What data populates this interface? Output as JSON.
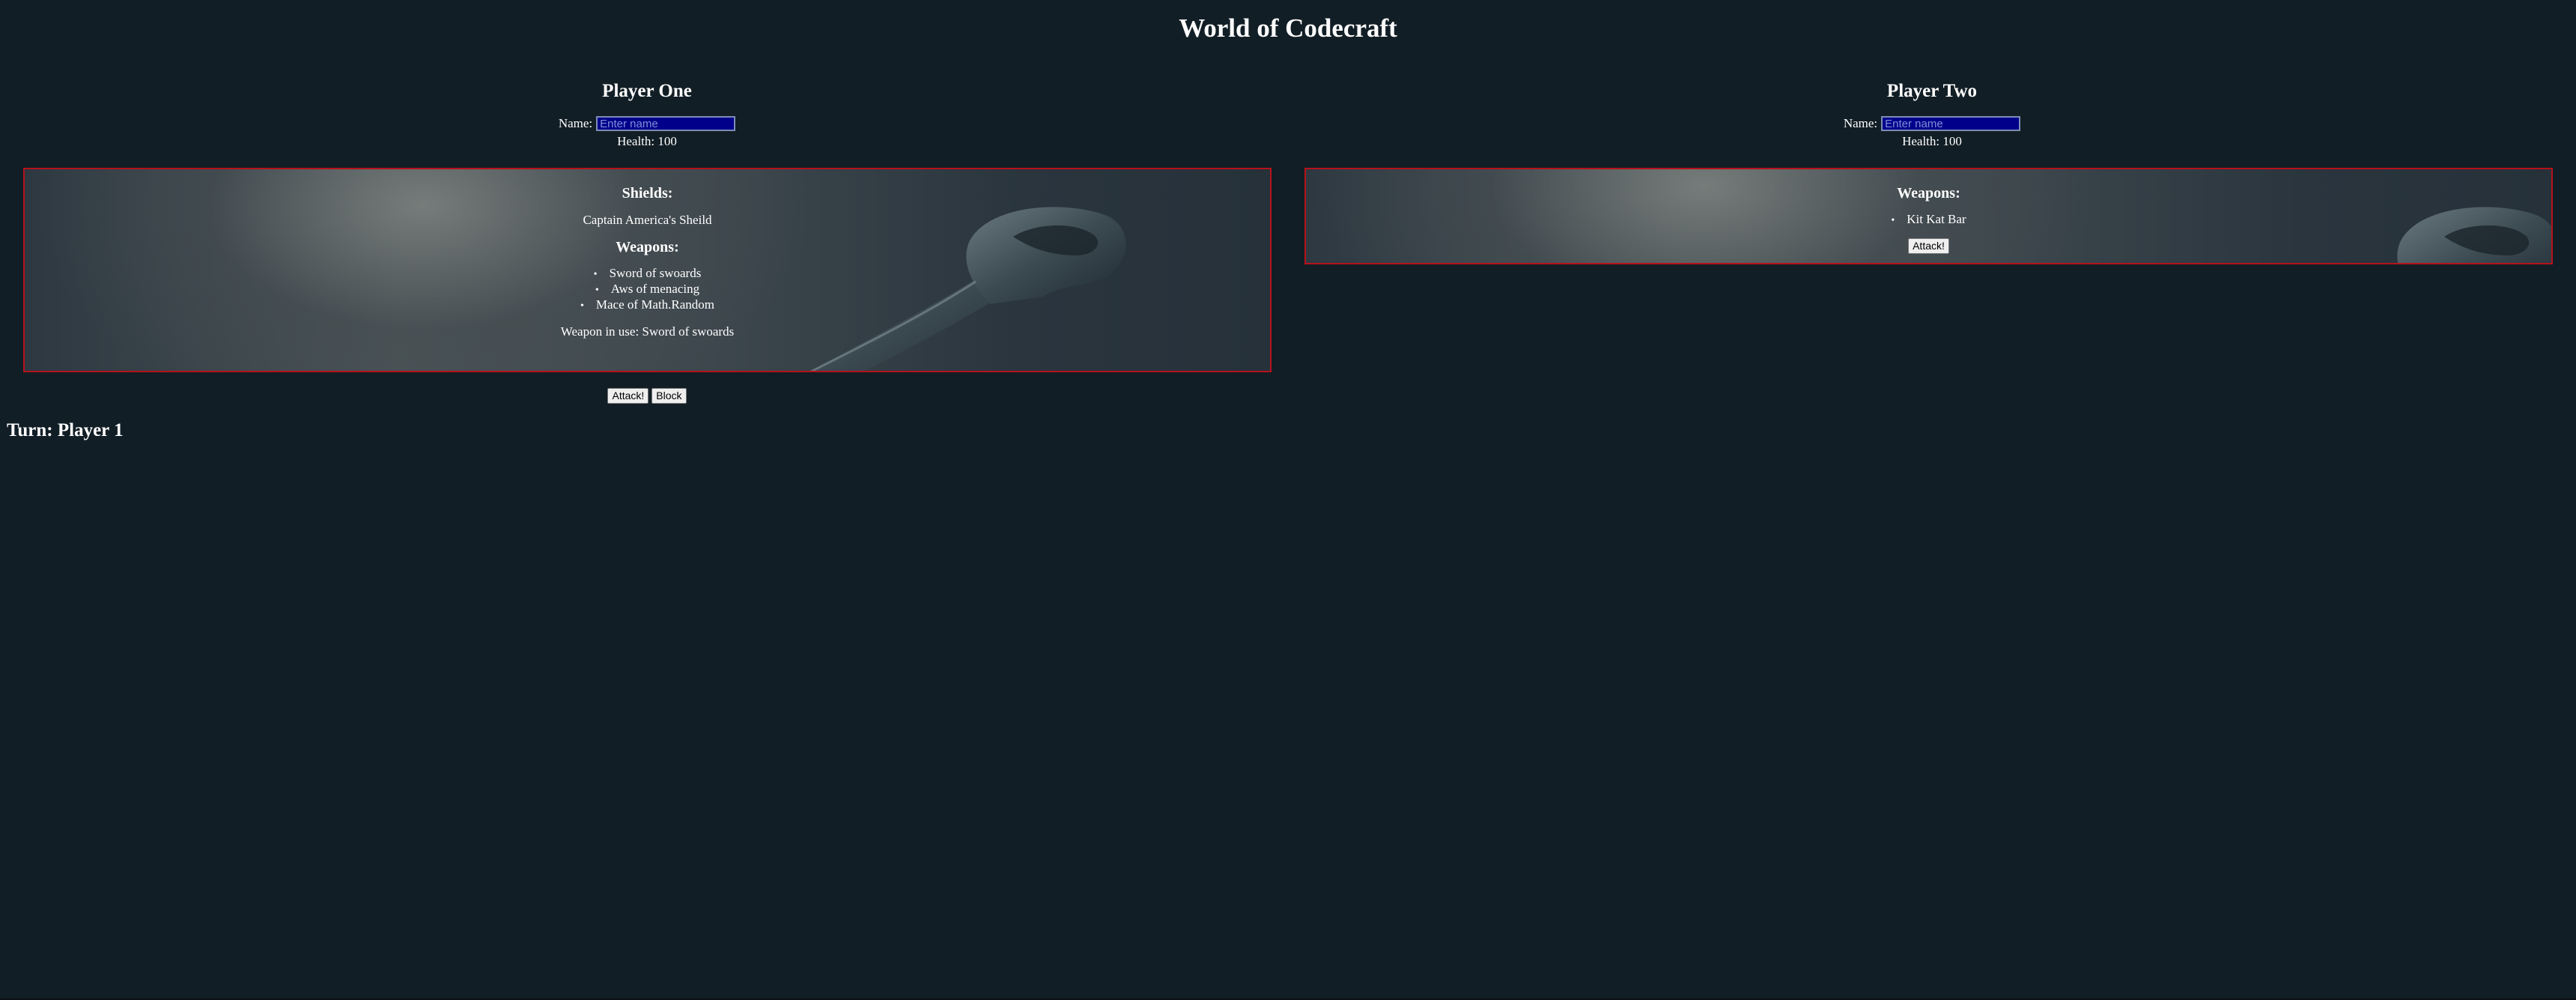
{
  "app": {
    "title": "World of Codecraft"
  },
  "colors": {
    "background": "#121e25",
    "panel_border": "#b5121b",
    "input_background": "#00008b"
  },
  "players": [
    {
      "title": "Player One",
      "name_label": "Name:",
      "name_value": "",
      "name_placeholder": "Enter name",
      "health_text": "Health: 100",
      "shields_heading": "Shields:",
      "shield": "Captain America's Sheild",
      "weapons_heading": "Weapons:",
      "weapons": [
        "Sword of swoards",
        "Aws of menacing",
        "Mace of Math.Random"
      ],
      "weapon_in_use": "Weapon in use: Sword of swoards",
      "actions": {
        "attack_label": "Attack!",
        "block_label": "Block"
      }
    },
    {
      "title": "Player Two",
      "name_label": "Name:",
      "name_value": "",
      "name_placeholder": "Enter name",
      "health_text": "Health: 100",
      "weapons_heading": "Weapons:",
      "weapons": [
        "Kit Kat Bar"
      ],
      "actions": {
        "attack_label": "Attack!"
      }
    }
  ],
  "turn": {
    "text": "Turn: Player 1"
  },
  "decor": {
    "background_icon": "hammer-icon"
  }
}
